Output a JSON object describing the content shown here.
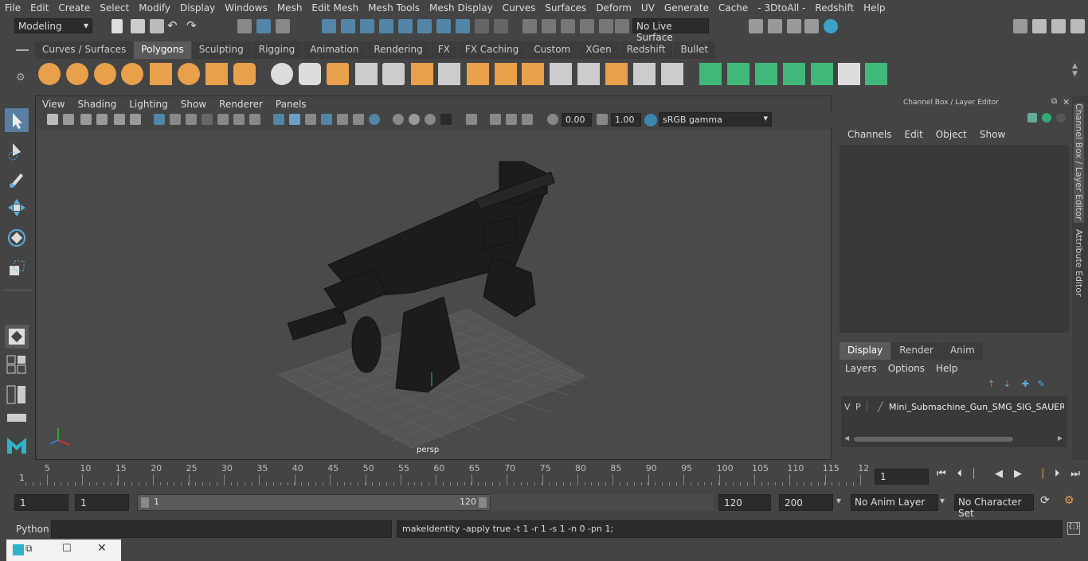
{
  "menubar": {
    "items": [
      "File",
      "Edit",
      "Create",
      "Select",
      "Modify",
      "Display",
      "Windows",
      "Mesh",
      "Edit Mesh",
      "Mesh Tools",
      "Mesh Display",
      "Curves",
      "Surfaces",
      "Deform",
      "UV",
      "Generate",
      "Cache",
      "- 3DtoAll -",
      "Redshift",
      "Help"
    ]
  },
  "statusline": {
    "mode": "Modeling",
    "live_surface": "No Live Surface"
  },
  "shelf": {
    "tabs": [
      "Curves / Surfaces",
      "Polygons",
      "Sculpting",
      "Rigging",
      "Animation",
      "Rendering",
      "FX",
      "FX Caching",
      "Custom",
      "XGen",
      "Redshift",
      "Bullet"
    ],
    "active_tab": "Polygons"
  },
  "viewport": {
    "menu": [
      "View",
      "Shading",
      "Lighting",
      "Show",
      "Renderer",
      "Panels"
    ],
    "exposure": "0.00",
    "gamma": "1.00",
    "colorspace": "sRGB gamma",
    "camera_label": "persp"
  },
  "channelbox": {
    "title": "Channel Box / Layer Editor",
    "menu": [
      "Channels",
      "Edit",
      "Object",
      "Show"
    ]
  },
  "layer_editor": {
    "tabs": [
      "Display",
      "Render",
      "Anim"
    ],
    "active_tab": "Display",
    "menu": [
      "Layers",
      "Options",
      "Help"
    ],
    "layer": {
      "v": "V",
      "p": "P",
      "name": "Mini_Submachine_Gun_SMG_SIG_SAUER_M"
    }
  },
  "side_tabs": [
    "Channel Box / Layer Editor",
    "Attribute Editor"
  ],
  "timeline": {
    "ticks": [
      "5",
      "10",
      "15",
      "20",
      "25",
      "30",
      "35",
      "40",
      "45",
      "50",
      "55",
      "60",
      "65",
      "70",
      "75",
      "80",
      "85",
      "90",
      "95",
      "100",
      "105",
      "110",
      "115",
      "12"
    ],
    "start_label": "1",
    "current_frame": "1"
  },
  "range": {
    "start": "1",
    "playback_start": "1",
    "slider_start": "1",
    "slider_end": "120",
    "playback_end": "120",
    "end": "200",
    "anim_layer": "No Anim Layer",
    "character_set": "No Character Set"
  },
  "cmdline": {
    "label": "Python",
    "output": "makeIdentity -apply true -t 1 -r 1 -s 1 -n 0 -pn 1;"
  },
  "colors": {
    "bg": "#444444",
    "accent": "#5285a6",
    "orange": "#e8a04a",
    "green": "#3fb87a"
  }
}
